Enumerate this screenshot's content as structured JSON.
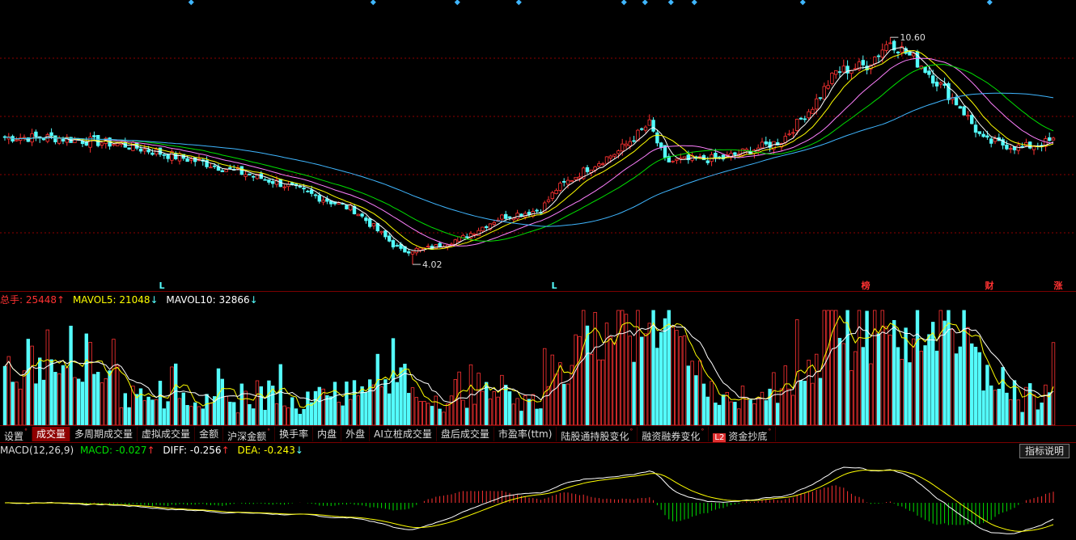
{
  "colors": {
    "up": "#ff3232",
    "down": "#54fcfc",
    "ma5": "#ffffff",
    "ma10": "#ffff00",
    "ma20": "#ff80ff",
    "ma30": "#00e000",
    "ma60": "#3fb6ff",
    "grid": "#8e0000"
  },
  "price_chart": {
    "high_label": "10.60",
    "low_label": "4.02",
    "markers": [
      {
        "x": 200,
        "text": "L",
        "color": "#54fcfc"
      },
      {
        "x": 685,
        "text": "L",
        "color": "#54fcfc"
      },
      {
        "x": 1070,
        "text": "榜",
        "color": "#ff3232"
      },
      {
        "x": 1223,
        "text": "财",
        "color": "#ff3232"
      },
      {
        "x": 1308,
        "text": "涨",
        "color": "#ff3232"
      }
    ],
    "event_diamonds_x": [
      237,
      462,
      566,
      642,
      772,
      798,
      830,
      859,
      993,
      1224
    ]
  },
  "volume_header": {
    "total_label": "总手: 25448",
    "total_arrow": "↑",
    "mavol5_label": "MAVOL5: 21048",
    "mavol5_arrow": "↓",
    "mavol10_label": "MAVOL10: 32866",
    "mavol10_arrow": "↓"
  },
  "tabs": [
    {
      "label": "设置",
      "dot": "°",
      "active": false
    },
    {
      "label": "成交量",
      "dot": "",
      "active": true
    },
    {
      "label": "多周期成交量",
      "dot": "",
      "active": false
    },
    {
      "label": "虚拟成交量",
      "dot": "",
      "active": false
    },
    {
      "label": "金额",
      "dot": "",
      "active": false
    },
    {
      "label": "沪深金额",
      "dot": "°",
      "active": false
    },
    {
      "label": "换手率",
      "dot": "",
      "active": false
    },
    {
      "label": "内盘",
      "dot": "",
      "active": false
    },
    {
      "label": "外盘",
      "dot": "",
      "active": false
    },
    {
      "label": "AI立桩成交量",
      "dot": "",
      "active": false
    },
    {
      "label": "盘后成交量",
      "dot": "",
      "active": false
    },
    {
      "label": "市盈率(ttm)",
      "dot": "",
      "active": false
    },
    {
      "label": "陆股通持股变化",
      "dot": "°",
      "active": false
    },
    {
      "label": "融资融券变化",
      "dot": "°",
      "active": false
    },
    {
      "label": "资金抄底",
      "dot": "°",
      "active": false,
      "badge": "L2"
    }
  ],
  "macd_header": {
    "name": "MACD(12,26,9)",
    "macd_label": "MACD: -0.027",
    "macd_arrow": "↑",
    "diff_label": "DIFF: -0.256",
    "diff_arrow": "↑",
    "dea_label": "DEA: -0.243",
    "dea_arrow": "↓",
    "explain_label": "指标说明"
  },
  "chart_data": [
    {
      "type": "candlestick",
      "ylim": [
        3.6,
        11.4
      ],
      "y_high": 10.6,
      "y_low": 4.02,
      "ma_periods": [
        5,
        10,
        20,
        30,
        60
      ],
      "anchors": [
        [
          0,
          7.7
        ],
        [
          12,
          7.7
        ],
        [
          30,
          7.5
        ],
        [
          50,
          7.0
        ],
        [
          70,
          6.4
        ],
        [
          90,
          5.6
        ],
        [
          102,
          4.4
        ],
        [
          110,
          4.5
        ],
        [
          118,
          4.8
        ],
        [
          128,
          5.4
        ],
        [
          138,
          5.6
        ],
        [
          142,
          6.2
        ],
        [
          150,
          6.8
        ],
        [
          158,
          7.3
        ],
        [
          166,
          8.1
        ],
        [
          170,
          7.0
        ],
        [
          185,
          7.1
        ],
        [
          200,
          7.6
        ],
        [
          208,
          8.6
        ],
        [
          214,
          9.6
        ],
        [
          222,
          9.8
        ],
        [
          228,
          10.5
        ],
        [
          236,
          9.8
        ],
        [
          246,
          8.6
        ],
        [
          252,
          7.6
        ],
        [
          262,
          7.4
        ],
        [
          270,
          7.6
        ]
      ]
    },
    {
      "type": "bar",
      "name": "成交量",
      "total": 25448,
      "mavol5": 21048,
      "mavol10": 32866
    },
    {
      "type": "bar",
      "name": "MACD(12,26,9)",
      "macd": -0.027,
      "diff": -0.256,
      "dea": -0.243
    }
  ]
}
